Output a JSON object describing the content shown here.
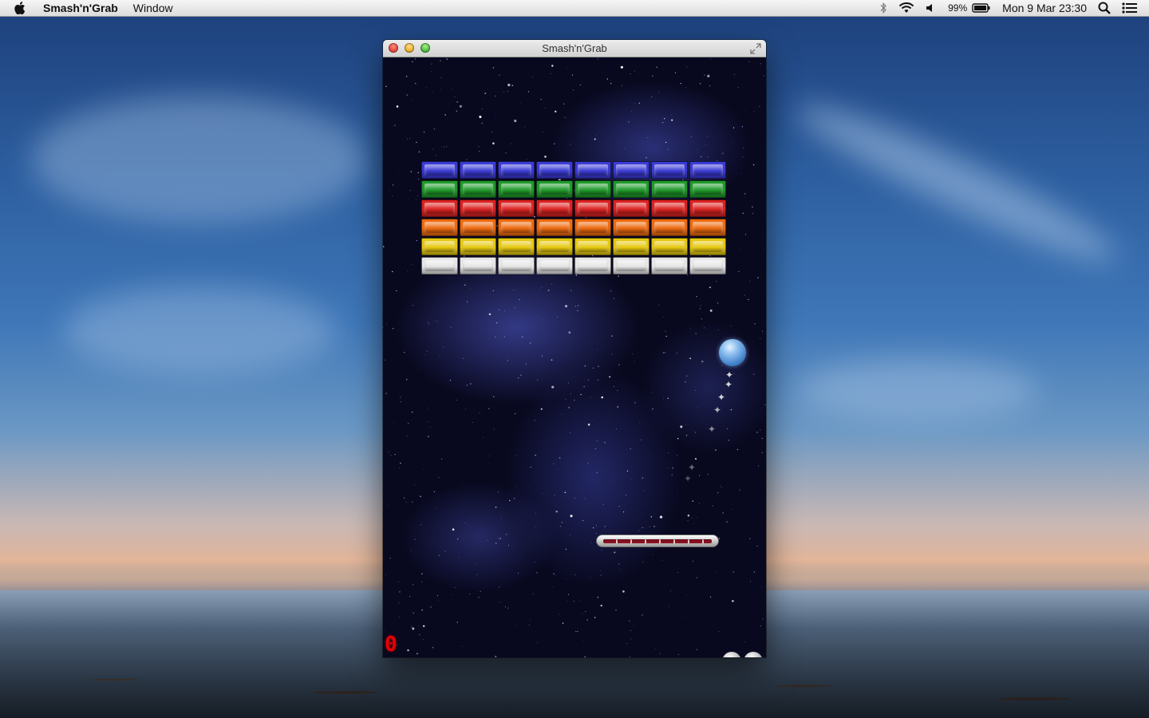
{
  "menubar": {
    "app_name": "Smash'n'Grab",
    "menus": [
      "Window"
    ],
    "status": {
      "battery_percent": "99%",
      "datetime": "Mon 9 Mar  23:30"
    }
  },
  "window": {
    "title": "Smash'n'Grab"
  },
  "game": {
    "score": "0",
    "lives_remaining": 2,
    "brick_rows": [
      {
        "color": "blue",
        "hex": "#3b3bd6",
        "count": 8
      },
      {
        "color": "green",
        "hex": "#1f9a2a",
        "count": 8
      },
      {
        "color": "red",
        "hex": "#dd2222",
        "count": 8
      },
      {
        "color": "orange",
        "hex": "#ee6a10",
        "count": 8
      },
      {
        "color": "yellow",
        "hex": "#e6c80e",
        "count": 8
      },
      {
        "color": "white",
        "hex": "#e6e6e6",
        "count": 8
      }
    ],
    "ball_color": "#5b95da",
    "score_color": "#e60000"
  }
}
